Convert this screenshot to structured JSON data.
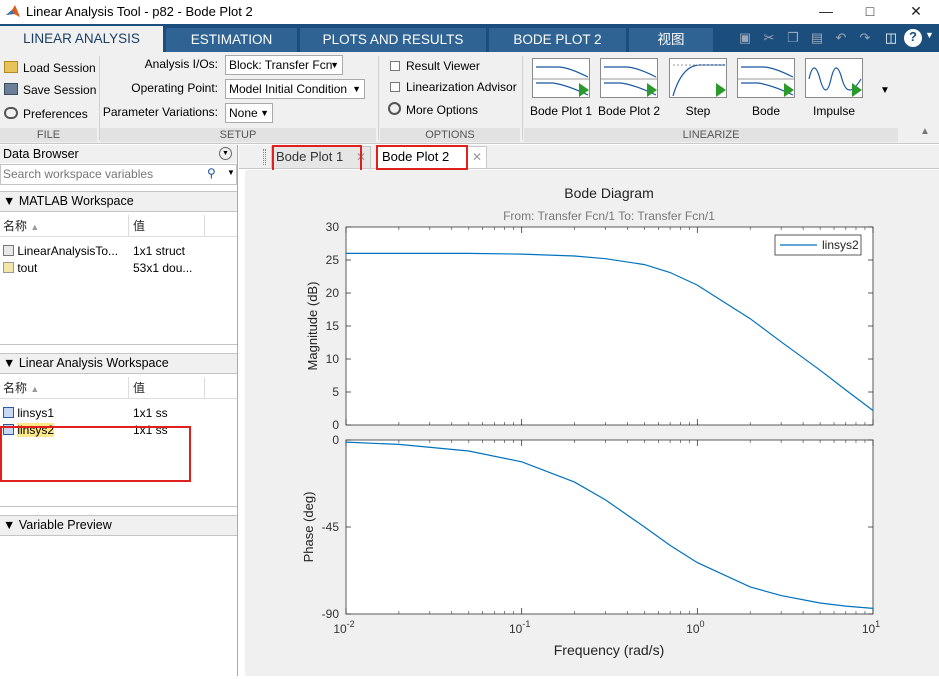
{
  "window": {
    "title": "Linear Analysis Tool - p82 - Bode Plot 2",
    "icon": "matlab-logo-icon",
    "controls": [
      "minimize-icon",
      "maximize-icon",
      "close-icon"
    ]
  },
  "ribbon_tabs": [
    {
      "label": "LINEAR ANALYSIS",
      "active": true
    },
    {
      "label": "ESTIMATION",
      "active": false
    },
    {
      "label": "PLOTS AND RESULTS",
      "active": false
    },
    {
      "label": "BODE PLOT 2",
      "active": false
    },
    {
      "label": "视图",
      "active": false
    }
  ],
  "quick_access": [
    "save-icon",
    "cut-icon",
    "copy-icon",
    "paste-icon",
    "undo-icon",
    "redo-icon",
    "window-icon",
    "help-icon"
  ],
  "ribbon": {
    "file": {
      "load": "Load Session",
      "save": "Save Session",
      "prefs": "Preferences",
      "label": "FILE"
    },
    "setup": {
      "io_label": "Analysis I/Os:",
      "io_value": "Block: Transfer Fcn",
      "op_label": "Operating Point:",
      "op_value": "Model Initial Condition",
      "pv_label": "Parameter Variations:",
      "pv_value": "None",
      "label": "SETUP"
    },
    "options": {
      "result_viewer": "Result Viewer",
      "lin_advisor": "Linearization Advisor",
      "more": "More Options",
      "label": "OPTIONS"
    },
    "linearize": {
      "buttons": [
        "Bode Plot 1",
        "Bode Plot 2",
        "Step",
        "Bode",
        "Impulse"
      ],
      "label": "LINEARIZE"
    }
  },
  "data_browser": {
    "title": "Data Browser",
    "search_placeholder": "Search workspace variables",
    "matlab_ws": {
      "title": "MATLAB Workspace",
      "col_name": "名称",
      "col_value": "值",
      "rows": [
        {
          "name": "LinearAnalysisTo...",
          "value": "1x1 struct"
        },
        {
          "name": "tout",
          "value": "53x1 dou..."
        }
      ]
    },
    "linear_ws": {
      "title": "Linear Analysis Workspace",
      "col_name": "名称",
      "col_value": "值",
      "rows": [
        {
          "name": "linsys1",
          "value": "1x1 ss"
        },
        {
          "name": "linsys2",
          "value": "1x1 ss"
        }
      ]
    },
    "preview": {
      "title": "Variable Preview"
    }
  },
  "doc_tabs": [
    {
      "label": "Bode Plot 1",
      "selected": false
    },
    {
      "label": "Bode Plot 2",
      "selected": true
    }
  ],
  "chart_data": {
    "type": "line",
    "title": "Bode Diagram",
    "subtitle": "From: Transfer Fcn/1  To: Transfer Fcn/1",
    "xlabel": "Frequency  (rad/s)",
    "x_scale": "log",
    "xlim": [
      0.01,
      10
    ],
    "x_ticks": [
      {
        "base": "10",
        "exp": "-2"
      },
      {
        "base": "10",
        "exp": "-1"
      },
      {
        "base": "10",
        "exp": "0"
      },
      {
        "base": "10",
        "exp": "1"
      }
    ],
    "legend": {
      "placement": "top-right",
      "entries": [
        "linsys2"
      ]
    },
    "line_color": "#0072bd",
    "magnitude": {
      "ylabel": "Magnitude (dB)",
      "ylim": [
        0,
        30
      ],
      "yticks": [
        "30",
        "25",
        "20",
        "15",
        "10",
        "5",
        "0"
      ],
      "series": [
        {
          "name": "linsys2",
          "x": [
            0.01,
            0.02,
            0.05,
            0.1,
            0.2,
            0.3,
            0.5,
            0.7,
            1,
            2,
            3,
            5,
            7,
            10
          ],
          "y": [
            26,
            26,
            26,
            25.9,
            25.6,
            25.2,
            24.3,
            23.1,
            21.2,
            16.1,
            12.6,
            8.3,
            5.3,
            2.2
          ]
        }
      ]
    },
    "phase": {
      "ylabel": "Phase (deg)",
      "ylim": [
        -90,
        0
      ],
      "yticks": [
        "0",
        "-45",
        "-90"
      ],
      "series": [
        {
          "name": "linsys2",
          "x": [
            0.01,
            0.02,
            0.05,
            0.1,
            0.2,
            0.3,
            0.5,
            0.7,
            1,
            2,
            3,
            5,
            7,
            10
          ],
          "y": [
            -1.1,
            -2.3,
            -5.7,
            -11.3,
            -21.8,
            -31,
            -45,
            -54.5,
            -63.4,
            -76,
            -80.5,
            -84.3,
            -85.9,
            -87.1
          ]
        }
      ]
    }
  }
}
